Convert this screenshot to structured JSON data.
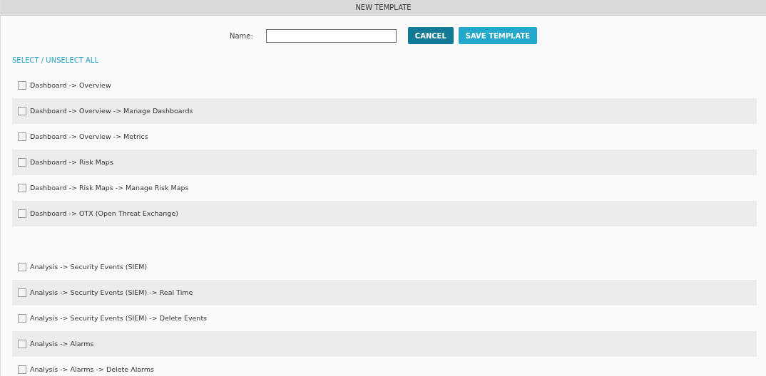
{
  "header": {
    "title": "NEW TEMPLATE"
  },
  "name_field": {
    "label": "Name:"
  },
  "buttons": [
    {
      "kind": "secondary",
      "label": "CANCEL"
    },
    {
      "kind": "primary",
      "label": "SAVE TEMPLATE"
    }
  ],
  "select_all": {
    "label": "SELECT / UNSELECT ALL"
  },
  "groups": [
    {
      "items": [
        {
          "label": "Dashboard -> Overview",
          "checked": false
        },
        {
          "label": "Dashboard -> Overview -> Manage Dashboards",
          "checked": false
        },
        {
          "label": "Dashboard -> Overview -> Metrics",
          "checked": false
        },
        {
          "label": "Dashboard -> Risk Maps",
          "checked": false
        },
        {
          "label": "Dashboard -> Risk Maps -> Manage Risk Maps",
          "checked": false
        },
        {
          "label": "Dashboard -> OTX (Open Threat Exchange)",
          "checked": false
        }
      ]
    },
    {
      "items": [
        {
          "label": "Analysis -> Security Events (SIEM)",
          "checked": false
        },
        {
          "label": "Analysis -> Security Events (SIEM) -> Real Time",
          "checked": false
        },
        {
          "label": "Analysis -> Security Events (SIEM) -> Delete Events",
          "checked": false
        },
        {
          "label": "Analysis -> Alarms",
          "checked": false
        },
        {
          "label": "Analysis -> Alarms -> Delete Alarms",
          "checked": false
        }
      ]
    }
  ]
}
